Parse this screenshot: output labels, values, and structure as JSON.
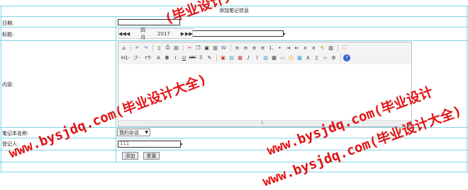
{
  "form": {
    "title": "添加笔记信息",
    "date_label": "日期:",
    "title_label": "标题:",
    "content_label": "内容:",
    "notebook_label": "笔记本名称:",
    "recorder_label": "登记人:",
    "notebook_selected": "我的杂谈",
    "recorder_value": "111",
    "add_button": "添加",
    "reset_button": "重置"
  },
  "calendar": {
    "prev_year": "◀◀",
    "prev_month": "◀",
    "month": "四月",
    "year": "2017",
    "next_month": "▶",
    "next_year": "▶▶"
  },
  "editor": {
    "row1_icons": [
      "source-icon",
      "undo-icon",
      "redo-icon",
      "new-doc-icon",
      "print-icon",
      "preview-icon",
      "cut-icon",
      "copy-icon",
      "paste-icon",
      "paste-text-icon",
      "paste-word-icon",
      "align-left-icon",
      "align-center-icon",
      "align-right-icon",
      "justify-icon",
      "ordered-list-icon",
      "unordered-list-icon",
      "indent-icon",
      "outdent-icon",
      "subscript-icon",
      "superscript-icon",
      "clear-format-icon",
      "select-all-icon",
      "full-screen-icon"
    ],
    "row2_labels": [
      "H1-",
      "ℱ-",
      "тT-",
      "A",
      "B",
      "I",
      "U",
      "ABC"
    ],
    "resize_glyph": "⇕",
    "grip_glyph": "◢"
  },
  "watermark": {
    "text_1": "(毕业设计大全)",
    "text_2": "www.bysjdq.com(毕业设计大全)",
    "text_3": "www.bysjdq.com(毕业设计",
    "text_4": "www.bysjdq.com(毕业设计大全)",
    "color": "#e00000"
  },
  "colors": {
    "grid_line": "#7fd4e8"
  }
}
